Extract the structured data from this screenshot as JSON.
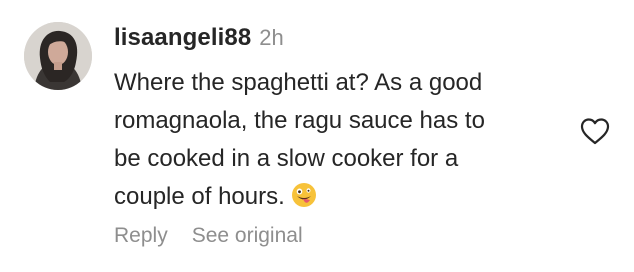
{
  "comment": {
    "username": "lisaangeli88",
    "timestamp": "2h",
    "text_lines": [
      "Where the spaghetti at? As a good",
      "romagnaola, the ragu sauce has to",
      "be cooked in a slow cooker for a",
      "couple of hours."
    ],
    "emoji": "zany-face-tongue-out-emoji",
    "actions": {
      "reply": "Reply",
      "see_original": "See original"
    },
    "like_icon": "heart-outline-icon"
  },
  "colors": {
    "text": "#262626",
    "secondary": "#8e8e8e",
    "emoji_yellow": "#f7c23a",
    "emoji_tongue": "#e5586a"
  }
}
